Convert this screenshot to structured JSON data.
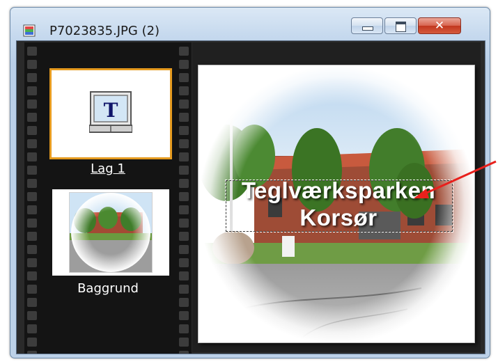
{
  "window": {
    "title": "P7023835.JPG (2)",
    "icon": "image-document-icon",
    "controls": {
      "minimize": "minimize-icon",
      "maximize": "maximize-icon",
      "close": "close-icon",
      "close_glyph": "✕"
    }
  },
  "layers": [
    {
      "label": "Lag 1",
      "icon": "text-layer-icon",
      "selected": true
    },
    {
      "label": "Baggrund",
      "icon": "photo-thumbnail",
      "selected": false
    }
  ],
  "canvas": {
    "text_line1": "Teglværksparken",
    "text_line2": "Korsør"
  },
  "colors": {
    "selection_border": "#e59a1f",
    "annotation_arrow": "#e8201c",
    "close_button": "#c2371f"
  }
}
